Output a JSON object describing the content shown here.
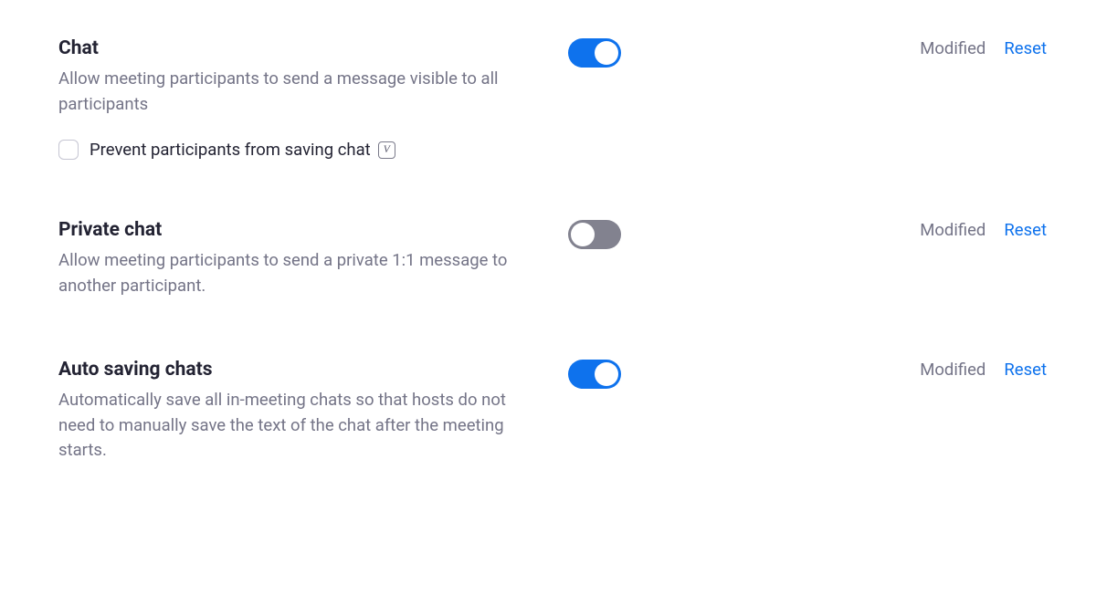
{
  "settings": [
    {
      "title": "Chat",
      "description": "Allow meeting participants to send a message visible to all participants",
      "enabled": true,
      "modified_label": "Modified",
      "reset_label": "Reset",
      "sub_option": {
        "label": "Prevent participants from saving chat",
        "checked": false
      }
    },
    {
      "title": "Private chat",
      "description": "Allow meeting participants to send a private 1:1 message to another participant.",
      "enabled": false,
      "modified_label": "Modified",
      "reset_label": "Reset"
    },
    {
      "title": "Auto saving chats",
      "description": "Automatically save all in-meeting chats so that hosts do not need to manually save the text of the chat after the meeting starts.",
      "enabled": true,
      "modified_label": "Modified",
      "reset_label": "Reset"
    }
  ]
}
